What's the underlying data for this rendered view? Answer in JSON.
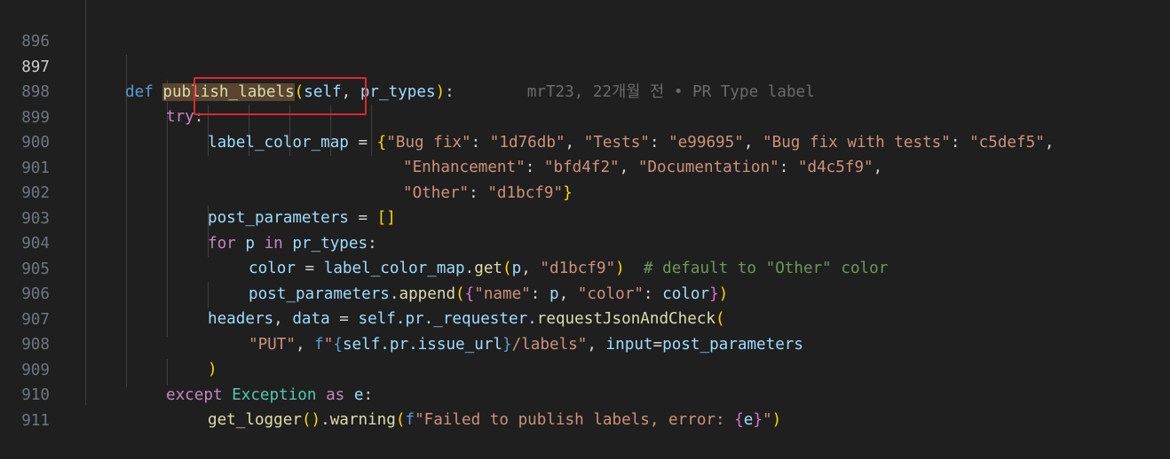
{
  "lines": [
    {
      "num": "896"
    },
    {
      "num": "897",
      "def": "def",
      "fname": "publish_labels",
      "open": "(",
      "p1": "self",
      "comma": ", ",
      "p2": "pr_types",
      "close": ")",
      "colon": ":",
      "blame": "mrT23, 22개월 전 • PR Type label"
    },
    {
      "num": "898",
      "try": "try",
      "colon": ":"
    },
    {
      "num": "899",
      "var": "label_color_map",
      "eq": " = ",
      "brace": "{",
      "k1": "\"Bug fix\"",
      "c1": ": ",
      "v1": "\"1d76db\"",
      "s1": ", ",
      "k2": "\"Tests\"",
      "c2": ": ",
      "v2": "\"e99695\"",
      "s2": ", ",
      "k3": "\"Bug fix with tests\"",
      "c3": ": ",
      "v3": "\"c5def5\"",
      "s3": ","
    },
    {
      "num": "900",
      "k1": "\"Enhancement\"",
      "c1": ": ",
      "v1": "\"bfd4f2\"",
      "s1": ", ",
      "k2": "\"Documentation\"",
      "c2": ": ",
      "v2": "\"d4c5f9\"",
      "s2": ","
    },
    {
      "num": "901",
      "k1": "\"Other\"",
      "c1": ": ",
      "v1": "\"d1bcf9\"",
      "brace": "}"
    },
    {
      "num": "902",
      "var": "post_parameters",
      "eq": " = ",
      "br": "[]"
    },
    {
      "num": "903",
      "for": "for",
      "p": " p ",
      "in": "in",
      "sp": " ",
      "pr": "pr_types",
      "colon": ":"
    },
    {
      "num": "904",
      "var": "color",
      "eq": " = ",
      "obj": "label_color_map",
      "dot": ".",
      "meth": "get",
      "open": "(",
      "arg": "p",
      "comma": ", ",
      "str": "\"d1bcf9\"",
      "close": ")",
      "cmt": "  # default to \"Other\" color"
    },
    {
      "num": "905",
      "var": "post_parameters",
      "dot": ".",
      "meth": "append",
      "open": "(",
      "brace": "{",
      "k1": "\"name\"",
      "c1": ": ",
      "v1": "p",
      "s1": ", ",
      "k2": "\"color\"",
      "c2": ": ",
      "v2": "color",
      "brace2": "}",
      "close": ")"
    },
    {
      "num": "906",
      "v1": "headers",
      "comma": ", ",
      "v2": "data",
      "eq": " = ",
      "self": "self",
      "chain": ".pr._requester.",
      "meth": "requestJsonAndCheck",
      "open": "("
    },
    {
      "num": "907",
      "s1": "\"PUT\"",
      "comma": ", ",
      "f": "f",
      "q1": "\"",
      "ob": "{",
      "expr": "self.pr.issue_url",
      "cb": "}",
      "rest": "/labels\"",
      "comma2": ", ",
      "kw": "input",
      "eq": "=",
      "arg": "post_parameters"
    },
    {
      "num": "908",
      "close": ")"
    },
    {
      "num": "909",
      "except": "except",
      "sp": " ",
      "cls": "Exception",
      "as": " as ",
      "e": "e",
      "colon": ":"
    },
    {
      "num": "910",
      "fn": "get_logger",
      "pp": "()",
      "dot": ".",
      "meth": "warning",
      "open": "(",
      "f": "f",
      "str": "\"Failed to publish labels, error: ",
      "ob": "{",
      "e": "e",
      "cb": "}",
      "q": "\"",
      "close": ")"
    },
    {
      "num": "911"
    }
  ]
}
